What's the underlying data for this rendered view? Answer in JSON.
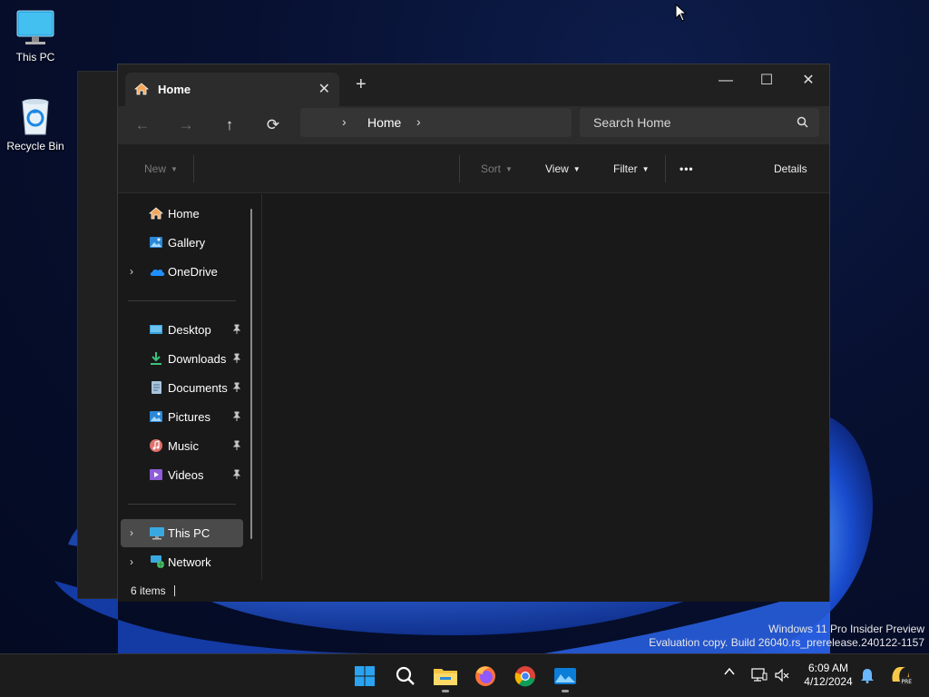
{
  "desktop": {
    "icons": [
      {
        "label": "This PC",
        "icon": "monitor-icon"
      },
      {
        "label": "Recycle Bin",
        "icon": "recycle-bin-icon"
      }
    ],
    "watermark": {
      "line1": "Windows 11 Pro Insider Preview",
      "line2": "Evaluation copy. Build 26040.rs_prerelease.240122-1157"
    }
  },
  "explorer": {
    "tab": {
      "label": "Home",
      "close": "✕",
      "icon": "home-icon"
    },
    "new_tab": "+",
    "window_controls": {
      "minimize": "—",
      "maximize": "☐",
      "close": "✕"
    },
    "nav": {
      "back": "←",
      "forward": "→",
      "up": "↑",
      "refresh": "⟳"
    },
    "address": {
      "chevron": "›",
      "text": "Home",
      "chevron_after": "›"
    },
    "search": {
      "placeholder": "Search Home",
      "icon": "search-icon"
    },
    "toolbar": {
      "new": "New",
      "sort": "Sort",
      "view": "View",
      "filter": "Filter",
      "more": "•••",
      "details": "Details"
    },
    "sidebar": {
      "items": [
        {
          "label": "Home",
          "icon": "home-icon",
          "expandable": false
        },
        {
          "label": "Gallery",
          "icon": "gallery-icon",
          "expandable": false
        },
        {
          "label": "OneDrive",
          "icon": "onedrive-icon",
          "expandable": true
        },
        {
          "label": "Desktop",
          "icon": "desktop-folder-icon",
          "pinned": true
        },
        {
          "label": "Downloads",
          "icon": "downloads-icon",
          "pinned": true
        },
        {
          "label": "Documents",
          "icon": "documents-icon",
          "pinned": true
        },
        {
          "label": "Pictures",
          "icon": "pictures-icon",
          "pinned": true
        },
        {
          "label": "Music",
          "icon": "music-icon",
          "pinned": true
        },
        {
          "label": "Videos",
          "icon": "videos-icon",
          "pinned": true
        },
        {
          "label": "This PC",
          "icon": "this-pc-icon",
          "expandable": true,
          "selected": true
        },
        {
          "label": "Network",
          "icon": "network-icon",
          "expandable": true
        }
      ],
      "expander": "›"
    },
    "status": {
      "items": "6 items"
    }
  },
  "taskbar": {
    "apps": [
      "windows-start-icon",
      "search-icon",
      "file-explorer-icon",
      "firefox-icon",
      "chrome-icon",
      "photos-icon"
    ],
    "tray": {
      "chevron": "^"
    },
    "clock": {
      "time": "6:09 AM",
      "date": "4/12/2024"
    }
  },
  "colors": {
    "accent": "#0067c0",
    "window_bg": "#191919",
    "titlebar_bg": "#202020",
    "selected_bg": "#4a4a4a"
  }
}
